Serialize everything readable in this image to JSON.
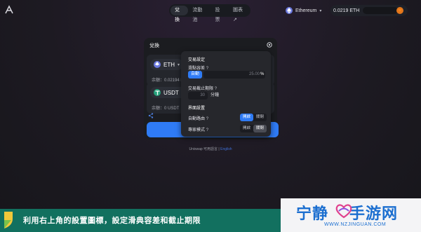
{
  "nav": {
    "tabs": [
      "兌換",
      "流動池",
      "投票",
      "圖表"
    ],
    "tab_arrow": "↗"
  },
  "network": {
    "name": "Ethereum",
    "icon": "ethereum-icon"
  },
  "wallet": {
    "balance": "0.0219 ETH",
    "icon": "metamask-fox-icon"
  },
  "swap": {
    "title": "兌換",
    "from": {
      "token": "ETH",
      "balance": "余額：0.02194 ETH"
    },
    "to": {
      "token": "USDT",
      "balance": "余額：0 USDT"
    }
  },
  "settings": {
    "trade_title": "交易設定",
    "slippage_label": "滑點容差",
    "help": "?",
    "auto_label": "自動",
    "slippage_placeholder": "25.00",
    "percent": "%",
    "deadline_label": "交易截止期限",
    "deadline_placeholder": "30",
    "deadline_unit": "分鐘",
    "interface_title": "界面設置",
    "auto_route_label": "自動路由",
    "expert_label": "專家模式",
    "on": "開啟",
    "off": "關閉"
  },
  "footer": {
    "text": "Uniswap 可用語言 | ",
    "lang": "English"
  },
  "banner": {
    "text": "利用右上角的設置圖標，設定滑典容差和截止期限",
    "brand": "宁静",
    "brand2": "手游网",
    "url": "WWW.NZJINGUAN.COM"
  },
  "colors": {
    "accent": "#2f7bf5",
    "banner": "#12705f",
    "brand": "#1c6fd0"
  }
}
